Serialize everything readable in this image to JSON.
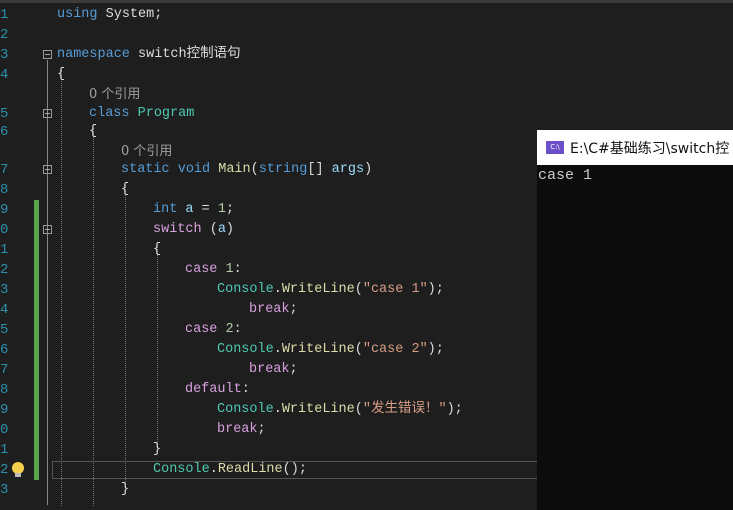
{
  "editor": {
    "line_numbers": [
      "1",
      "2",
      "3",
      "4",
      "5",
      "6",
      "7",
      "8",
      "9",
      "0",
      "1",
      "2",
      "3",
      "4",
      "5",
      "6",
      "7",
      "8",
      "9",
      "0",
      "1",
      "2",
      "3"
    ],
    "code_lens": [
      "0 个引用",
      "0 个引用"
    ],
    "lines": [
      [
        [
          "kw",
          "using"
        ],
        [
          "pl",
          " System;"
        ]
      ],
      [],
      [
        [
          "kw",
          "namespace"
        ],
        [
          "pl",
          " switch控制语句"
        ]
      ],
      [
        [
          "pl",
          "{"
        ]
      ],
      [
        [
          "kw",
          "class"
        ],
        [
          "pl",
          " "
        ],
        [
          "ty",
          "Program"
        ]
      ],
      [
        [
          "pl",
          "{"
        ]
      ],
      [
        [
          "kw",
          "static"
        ],
        [
          "pl",
          " "
        ],
        [
          "kw",
          "void"
        ],
        [
          "pl",
          " "
        ],
        [
          "me",
          "Main"
        ],
        [
          "pl",
          "("
        ],
        [
          "kw",
          "string"
        ],
        [
          "pl",
          "[] "
        ],
        [
          "id",
          "args"
        ],
        [
          "pl",
          ")"
        ]
      ],
      [
        [
          "pl",
          "{"
        ]
      ],
      [
        [
          "kw",
          "int"
        ],
        [
          "pl",
          " "
        ],
        [
          "id",
          "a"
        ],
        [
          "pl",
          " = "
        ],
        [
          "num",
          "1"
        ],
        [
          "pl",
          ";"
        ]
      ],
      [
        [
          "ctl",
          "switch"
        ],
        [
          "pl",
          " ("
        ],
        [
          "id",
          "a"
        ],
        [
          "pl",
          ")"
        ]
      ],
      [
        [
          "pl",
          "{"
        ]
      ],
      [
        [
          "ctl",
          "case"
        ],
        [
          "pl",
          " "
        ],
        [
          "num",
          "1"
        ],
        [
          "pl",
          ":"
        ]
      ],
      [
        [
          "ty",
          "Console"
        ],
        [
          "pl",
          "."
        ],
        [
          "me",
          "WriteLine"
        ],
        [
          "pl",
          "("
        ],
        [
          "str",
          "\"case 1\""
        ],
        [
          "pl",
          ");"
        ]
      ],
      [
        [
          "ctl",
          "break"
        ],
        [
          "pl",
          ";"
        ]
      ],
      [
        [
          "ctl",
          "case"
        ],
        [
          "pl",
          " "
        ],
        [
          "num",
          "2"
        ],
        [
          "pl",
          ":"
        ]
      ],
      [
        [
          "ty",
          "Console"
        ],
        [
          "pl",
          "."
        ],
        [
          "me",
          "WriteLine"
        ],
        [
          "pl",
          "("
        ],
        [
          "str",
          "\"case 2\""
        ],
        [
          "pl",
          ");"
        ]
      ],
      [
        [
          "ctl",
          "break"
        ],
        [
          "pl",
          ";"
        ]
      ],
      [
        [
          "ctl",
          "default"
        ],
        [
          "pl",
          ":"
        ]
      ],
      [
        [
          "ty",
          "Console"
        ],
        [
          "pl",
          "."
        ],
        [
          "me",
          "WriteLine"
        ],
        [
          "pl",
          "("
        ],
        [
          "str",
          "\"发生错误！\""
        ],
        [
          "pl",
          ");"
        ]
      ],
      [
        [
          "ctl",
          "break"
        ],
        [
          "pl",
          ";"
        ]
      ],
      [
        [
          "pl",
          "}"
        ]
      ],
      [
        [
          "ty",
          "Console"
        ],
        [
          "pl",
          "."
        ],
        [
          "me",
          "ReadLine"
        ],
        [
          "pl",
          "();"
        ]
      ],
      [
        [
          "pl",
          "}"
        ]
      ]
    ]
  },
  "console": {
    "title": "E:\\C#基础练习\\switch控",
    "icon_label": "C:\\",
    "output": "case 1"
  }
}
